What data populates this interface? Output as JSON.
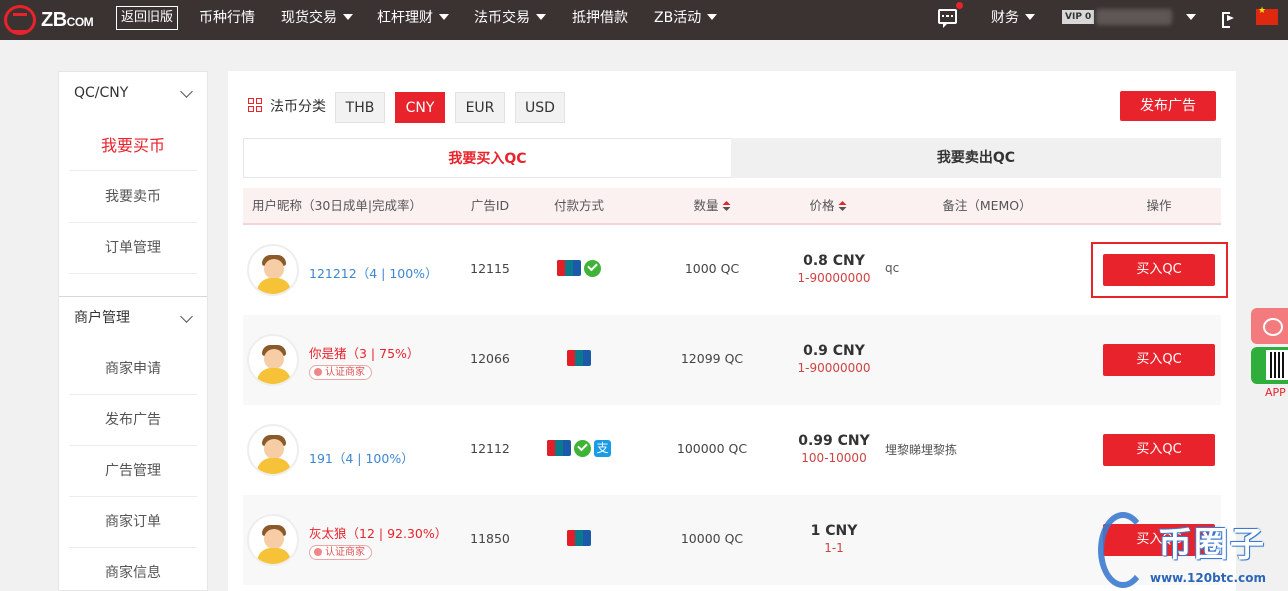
{
  "header": {
    "logo_text": "ZB",
    "logo_sub": "COM",
    "old_version": "返回旧版",
    "nav": [
      {
        "label": "币种行情",
        "dropdown": false
      },
      {
        "label": "现货交易",
        "dropdown": true
      },
      {
        "label": "杠杆理财",
        "dropdown": true
      },
      {
        "label": "法币交易",
        "dropdown": true
      },
      {
        "label": "抵押借款",
        "dropdown": false
      },
      {
        "label": "ZB活动",
        "dropdown": true
      }
    ],
    "finance": "财务",
    "vip": "VIP 0"
  },
  "sidebar": {
    "group1": "QC/CNY",
    "group1_items": [
      "我要买币",
      "我要卖币",
      "订单管理"
    ],
    "group2": "商户管理",
    "group2_items": [
      "商家申请",
      "发布广告",
      "广告管理",
      "商家订单",
      "商家信息"
    ]
  },
  "filters": {
    "label": "法币分类",
    "currencies": [
      "THB",
      "CNY",
      "EUR",
      "USD"
    ],
    "selected": "CNY",
    "post_ad": "发布广告"
  },
  "tabs": {
    "buy": "我要买入QC",
    "sell": "我要卖出QC"
  },
  "table": {
    "headers": [
      "用户昵称（30日成单|完成率）",
      "广告ID",
      "付款方式",
      "数量",
      "价格",
      "备注（MEMO）",
      "操作"
    ],
    "rows": [
      {
        "user": "121212（4 | 100%）",
        "certified": false,
        "ad_id": "12115",
        "payments": [
          "unionpay",
          "wechat"
        ],
        "quantity": "1000 QC",
        "price": "0.8 CNY",
        "range": "1-90000000",
        "memo": "qc",
        "action": "买入QC"
      },
      {
        "user": "你是猪（3 | 75%）",
        "certified": true,
        "ad_id": "12066",
        "payments": [
          "unionpay"
        ],
        "quantity": "12099 QC",
        "price": "0.9 CNY",
        "range": "1-90000000",
        "memo": "",
        "action": "买入QC"
      },
      {
        "user": "191（4 | 100%）",
        "certified": false,
        "ad_id": "12112",
        "payments": [
          "unionpay",
          "wechat",
          "alipay"
        ],
        "quantity": "100000 QC",
        "price": "0.99 CNY",
        "range": "100-10000",
        "memo": "埋黎睇埋黎拣",
        "action": "买入QC"
      },
      {
        "user": "灰太狼（12 | 92.30%）",
        "certified": true,
        "ad_id": "11850",
        "payments": [
          "unionpay"
        ],
        "quantity": "10000 QC",
        "price": "1 CNY",
        "range": "1-1",
        "memo": "",
        "action": "买入QC"
      }
    ],
    "cert_label": "认证商家"
  },
  "float": {
    "app": "APP"
  },
  "watermark": {
    "text": "币圈子",
    "url": "www.120btc.com"
  },
  "colors": {
    "accent": "#e8232c",
    "nav_bg": "#3a3331",
    "link_blue": "#3d86d1"
  }
}
